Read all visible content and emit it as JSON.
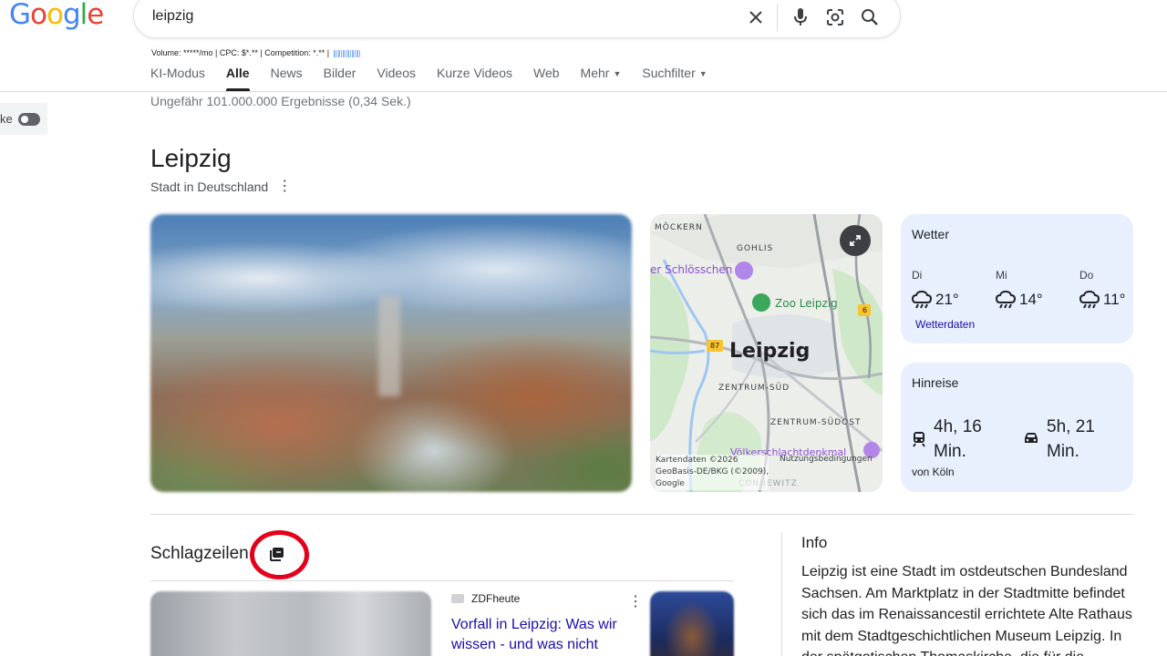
{
  "logo": {
    "letters": [
      "G",
      "o",
      "o",
      "g",
      "l",
      "e"
    ],
    "colors": [
      "#4285f4",
      "#ea4335",
      "#fbbc05",
      "#4285f4",
      "#34a853",
      "#ea4335"
    ]
  },
  "search": {
    "query": "leipzig",
    "placeholder": ""
  },
  "seo": {
    "text": "Volume: *****/mo | CPC: $*.** | Competition: *.** |"
  },
  "tabs": [
    {
      "label": "KI-Modus",
      "active": false
    },
    {
      "label": "Alle",
      "active": true
    },
    {
      "label": "News",
      "active": false
    },
    {
      "label": "Bilder",
      "active": false
    },
    {
      "label": "Videos",
      "active": false
    },
    {
      "label": "Kurze Videos",
      "active": false
    },
    {
      "label": "Web",
      "active": false
    },
    {
      "label": "Mehr",
      "active": false
    },
    {
      "label": "Suchfilter",
      "active": false
    }
  ],
  "results_count": "Ungefähr 101.000.000 Ergebnisse (0,34 Sek.)",
  "side_toggle_label": "ke",
  "knowledge": {
    "title": "Leipzig",
    "subtitle": "Stadt in Deutschland"
  },
  "map": {
    "labels": {
      "moeckern": "MÖCKERN",
      "gohlis": "GOHLIS",
      "schloesschen": "er Schlösschen",
      "zoo": "Zoo Leipzig",
      "city": "Leipzig",
      "zentrum_sued": "ZENTRUM-SÜD",
      "zentrum_suedost": "ZENTRUM-SÜDOST",
      "voelkerschlacht": "Völkerschlachtdenkmal",
      "connewitz": "CONNEWITZ",
      "road87": "87",
      "road6": "6"
    },
    "attribution": "Kartendaten ©2026\nGeoBasis-DE/BKG (©2009),\nGoogle",
    "terms": "Nutzungsbedingungen"
  },
  "weather": {
    "title": "Wetter",
    "days": [
      {
        "day": "Di",
        "temp": "21°",
        "icon": "rain-cloud-icon"
      },
      {
        "day": "Mi",
        "temp": "14°",
        "icon": "rain-cloud-icon"
      },
      {
        "day": "Do",
        "temp": "11°",
        "icon": "rain-cloud-icon"
      }
    ],
    "link": "Wetterdaten"
  },
  "travel": {
    "title": "Hinreise",
    "train": "4h, 16 Min.",
    "car": "5h, 21 Min.",
    "from": "von Köln"
  },
  "headlines": {
    "title": "Schlagzeilen",
    "source": "ZDFheute",
    "article_title": "Vorfall in Leipzig: Was wir wissen - und was nicht"
  },
  "info": {
    "title": "Info",
    "text": "Leipzig ist eine Stadt im ostdeutschen Bundesland Sachsen. Am Marktplatz in der Stadtmitte befindet sich das im Renaissancestil errichtete Alte Rathaus mit dem Stadtgeschichtlichen Museum Leipzig. In der spätgotischen Thomaskirche, die für die"
  },
  "colors": {
    "accent_red": "#e4001b",
    "link_blue": "#1a0dab",
    "card_bg": "#e8f0fe"
  }
}
